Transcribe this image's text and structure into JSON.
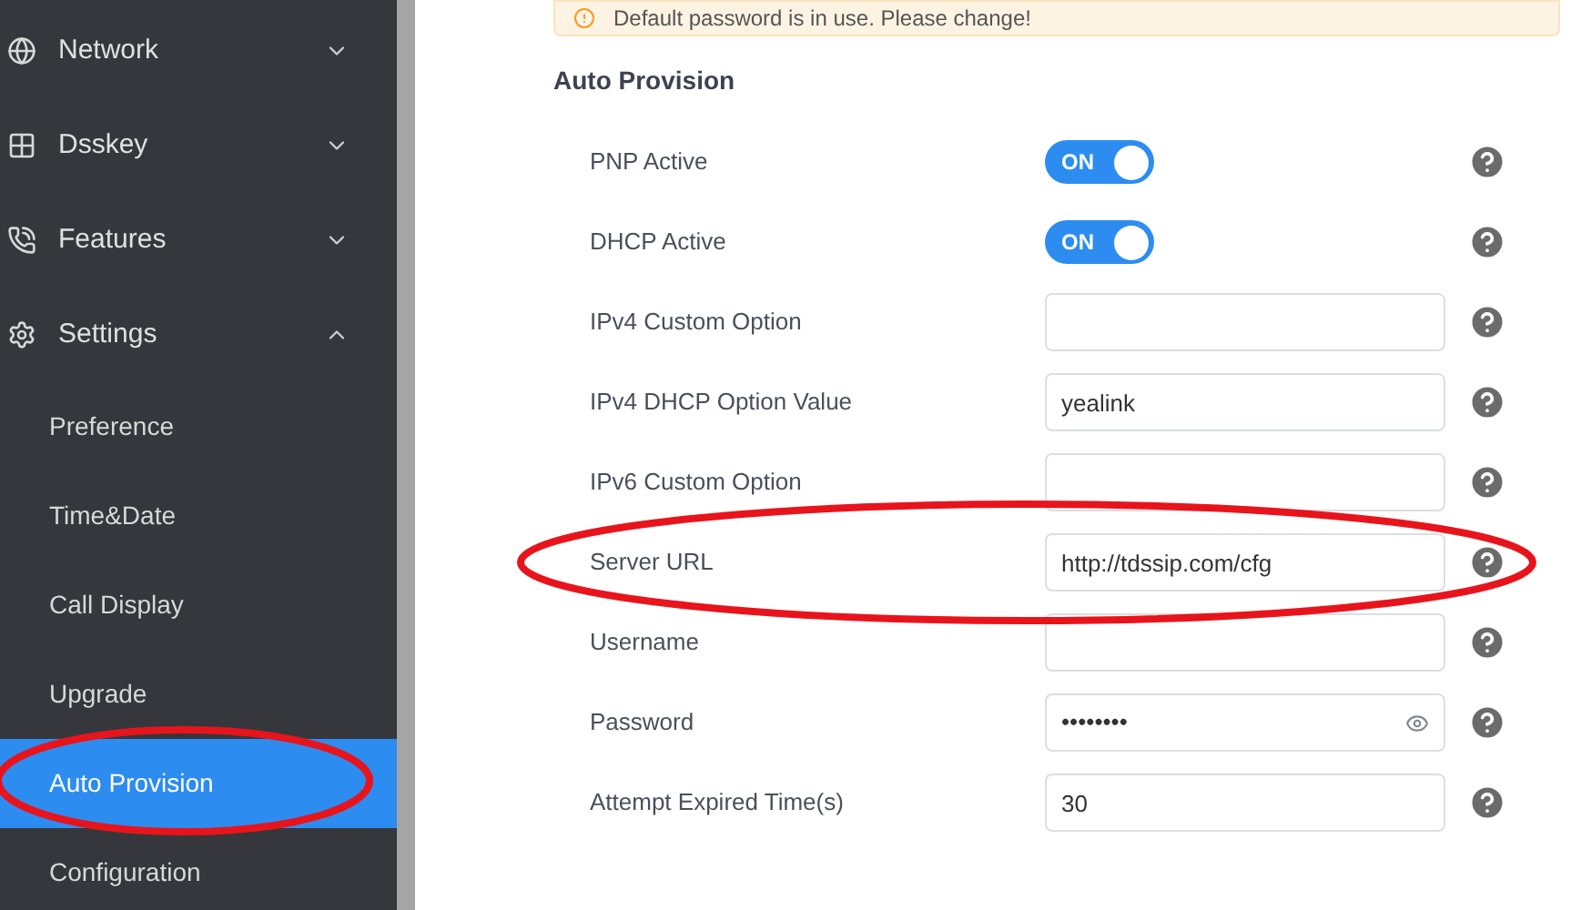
{
  "sidebar": {
    "items": [
      {
        "label": "Network",
        "expanded": false
      },
      {
        "label": "Dsskey",
        "expanded": false
      },
      {
        "label": "Features",
        "expanded": false
      },
      {
        "label": "Settings",
        "expanded": true,
        "children": [
          {
            "label": "Preference",
            "selected": false
          },
          {
            "label": "Time&Date",
            "selected": false
          },
          {
            "label": "Call Display",
            "selected": false
          },
          {
            "label": "Upgrade",
            "selected": false
          },
          {
            "label": "Auto Provision",
            "selected": true
          },
          {
            "label": "Configuration",
            "selected": false
          }
        ]
      }
    ]
  },
  "banner": {
    "text": "Default password is in use. Please change!"
  },
  "section_title": "Auto Provision",
  "fields": [
    {
      "kind": "switch",
      "label": "PNP Active",
      "on": true,
      "switch_text": "ON"
    },
    {
      "kind": "switch",
      "label": "DHCP Active",
      "on": true,
      "switch_text": "ON"
    },
    {
      "kind": "text",
      "label": "IPv4 Custom Option"
    },
    {
      "kind": "text",
      "label": "IPv4 DHCP Option Value",
      "value": "yealink"
    },
    {
      "kind": "text",
      "label": "IPv6 Custom Option"
    },
    {
      "kind": "text",
      "label": "Server URL",
      "value": "http://tdssip.com/cfg"
    },
    {
      "kind": "text",
      "label": "Username"
    },
    {
      "kind": "password",
      "label": "Password",
      "value": "••••••••"
    },
    {
      "kind": "text",
      "label": "Attempt Expired Time(s)",
      "value": "30"
    }
  ]
}
